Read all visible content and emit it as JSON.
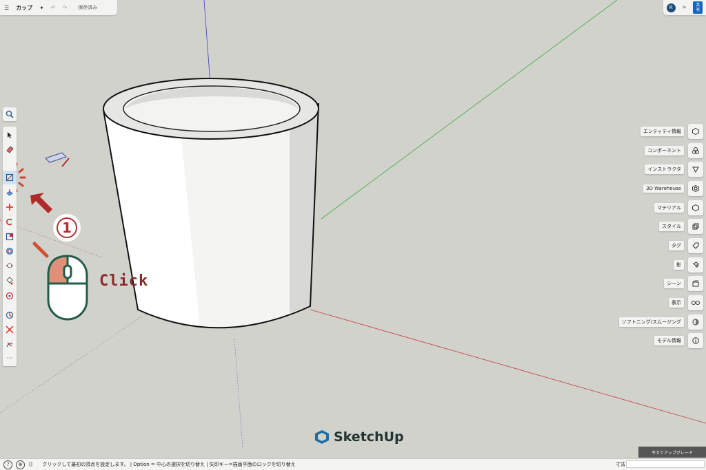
{
  "titlebar": {
    "title": "カップ",
    "saved": "保存済み"
  },
  "topright": {
    "avatar_initial": "R",
    "share_label_line1": "共",
    "share_label_line2": "有"
  },
  "right_panels": [
    {
      "label": "エンティティ情報",
      "icon": "entity-info-icon"
    },
    {
      "label": "コンポーネント",
      "icon": "components-icon"
    },
    {
      "label": "インストラクタ",
      "icon": "instructor-icon"
    },
    {
      "label": "3D Warehouse",
      "icon": "warehouse-icon"
    },
    {
      "label": "マテリアル",
      "icon": "materials-icon"
    },
    {
      "label": "スタイル",
      "icon": "styles-icon"
    },
    {
      "label": "タグ",
      "icon": "tags-icon"
    },
    {
      "label": "影",
      "icon": "shadows-icon"
    },
    {
      "label": "シーン",
      "icon": "scenes-icon"
    },
    {
      "label": "表示",
      "icon": "display-icon"
    },
    {
      "label": "ソフトニング/スムージング",
      "icon": "soften-icon"
    },
    {
      "label": "モデル情報",
      "icon": "model-info-icon"
    }
  ],
  "upgrade_label": "今すぐアップグレード",
  "status": {
    "text": "クリックして最初の頂点を設定します。 | Option = 中心の選択を切り替え | 矢印キー=描画平面のロックを切り替え",
    "measure_label": "寸法"
  },
  "logo_text": "SketchUp",
  "annotation": {
    "step_number": "1",
    "click_label": "Click"
  },
  "colors": {
    "accent_red": "#b03030",
    "share_blue": "#1565c0"
  }
}
